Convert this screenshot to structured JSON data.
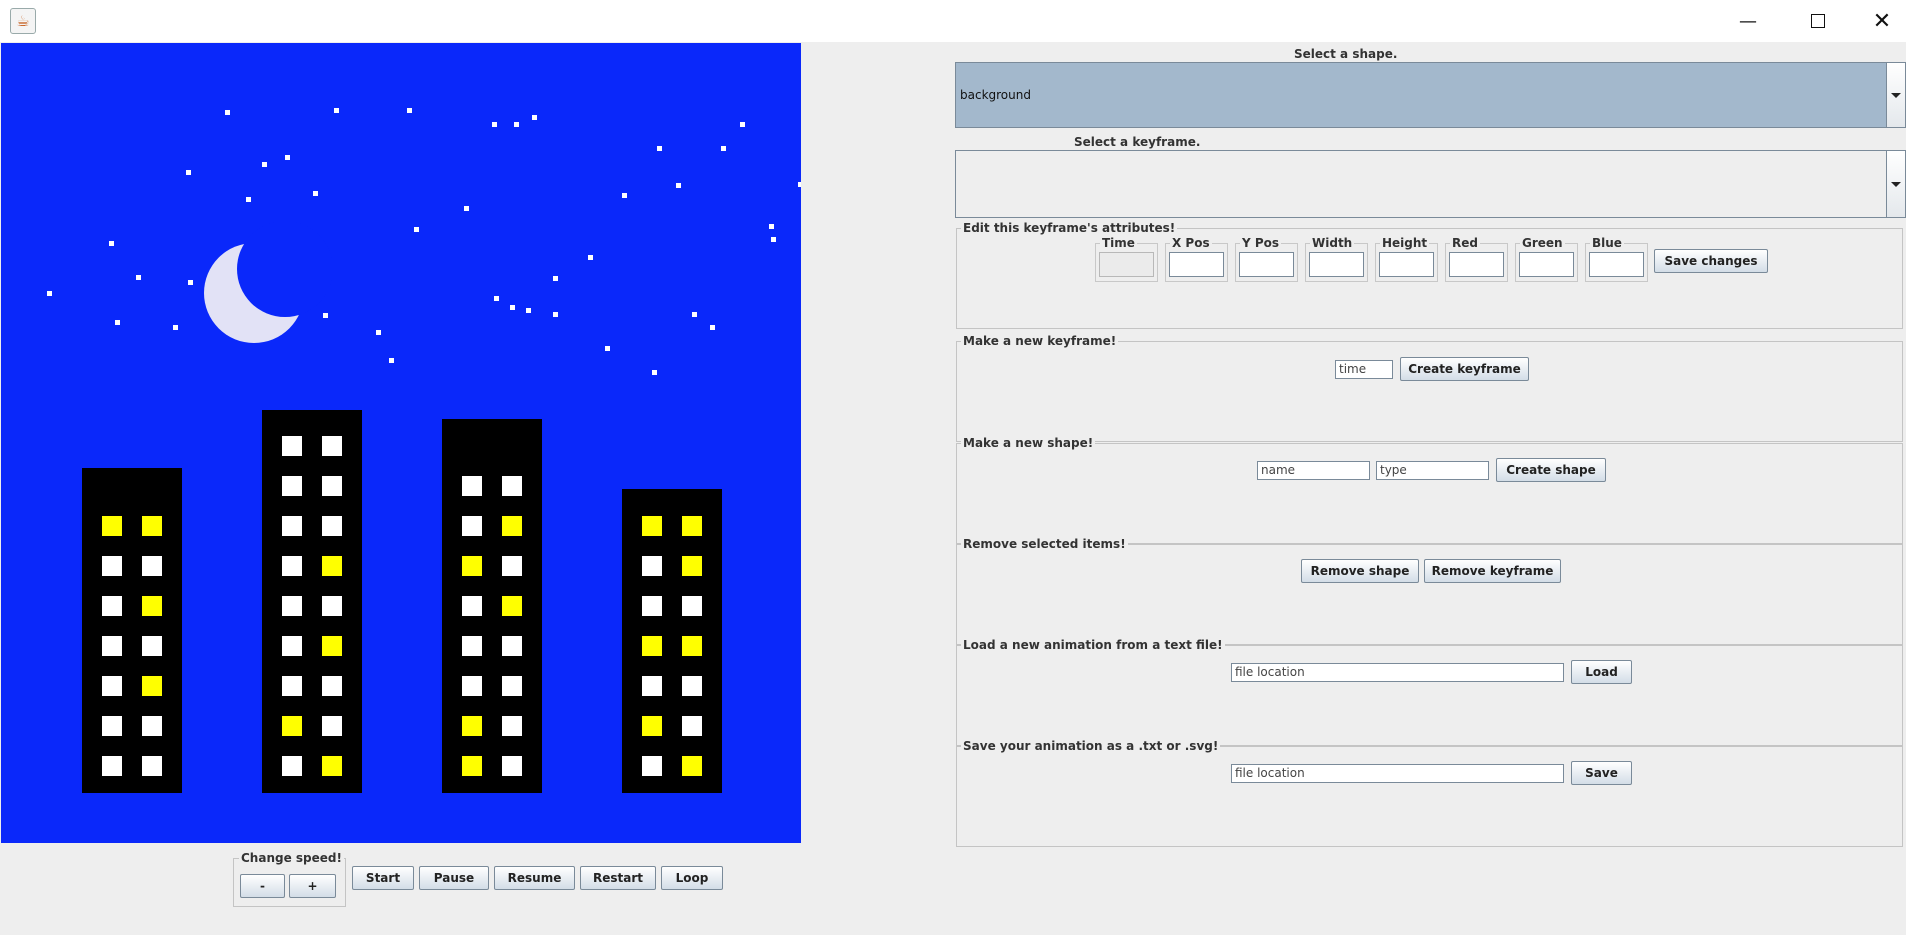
{
  "window": {
    "app_icon": "java-cup-icon",
    "minimize_icon": "minimize-icon",
    "maximize_icon": "maximize-icon",
    "close_icon": "close-icon"
  },
  "animation_canvas": {
    "background_color": "#0a28fa",
    "building_color": "#000000",
    "lit_window_color": "#ffff00",
    "unlit_window_color": "#ffffff",
    "moon_color": "#e2e2f6",
    "star_color": "#ffffff",
    "buildings": [
      {
        "rows": [
          [
            "lit",
            "lit"
          ],
          [
            "unlit",
            "unlit"
          ],
          [
            "unlit",
            "lit"
          ],
          [
            "unlit",
            "unlit"
          ],
          [
            "unlit",
            "lit"
          ],
          [
            "unlit",
            "unlit"
          ],
          [
            "unlit",
            "unlit"
          ]
        ]
      },
      {
        "rows": [
          [
            "unlit",
            "unlit"
          ],
          [
            "unlit",
            "unlit"
          ],
          [
            "unlit",
            "unlit"
          ],
          [
            "unlit",
            "lit"
          ],
          [
            "unlit",
            "unlit"
          ],
          [
            "unlit",
            "lit"
          ],
          [
            "unlit",
            "unlit"
          ],
          [
            "lit",
            "unlit"
          ],
          [
            "unlit",
            "lit"
          ]
        ]
      },
      {
        "rows": [
          [
            "unlit",
            "unlit"
          ],
          [
            "unlit",
            "lit"
          ],
          [
            "lit",
            "unlit"
          ],
          [
            "unlit",
            "lit"
          ],
          [
            "unlit",
            "unlit"
          ],
          [
            "unlit",
            "unlit"
          ],
          [
            "lit",
            "unlit"
          ],
          [
            "lit",
            "unlit"
          ]
        ]
      },
      {
        "rows": [
          [
            "lit",
            "lit"
          ],
          [
            "unlit",
            "lit"
          ],
          [
            "unlit",
            "unlit"
          ],
          [
            "lit",
            "lit"
          ],
          [
            "unlit",
            "unlit"
          ],
          [
            "lit",
            "unlit"
          ],
          [
            "unlit",
            "lit"
          ]
        ]
      }
    ]
  },
  "speed_panel": {
    "title": "Change speed!",
    "decrease_label": "-",
    "increase_label": "+"
  },
  "playback": {
    "start_label": "Start",
    "pause_label": "Pause",
    "resume_label": "Resume",
    "restart_label": "Restart",
    "loop_label": "Loop"
  },
  "shape_selector": {
    "label": "Select a shape.",
    "value": "background",
    "selected_bg": "#a3b8cc"
  },
  "keyframe_selector": {
    "label": "Select a keyframe.",
    "value": ""
  },
  "edit_keyframe": {
    "title": "Edit this keyframe's attributes!",
    "fields": [
      {
        "label": "Time",
        "value": "",
        "enabled": false
      },
      {
        "label": "X Pos",
        "value": "",
        "enabled": true
      },
      {
        "label": "Y Pos",
        "value": "",
        "enabled": true
      },
      {
        "label": "Width",
        "value": "",
        "enabled": true
      },
      {
        "label": "Height",
        "value": "",
        "enabled": true
      },
      {
        "label": "Red",
        "value": "",
        "enabled": true
      },
      {
        "label": "Green",
        "value": "",
        "enabled": true
      },
      {
        "label": "Blue",
        "value": "",
        "enabled": true
      }
    ],
    "save_label": "Save changes"
  },
  "new_keyframe": {
    "title": "Make a new keyframe!",
    "time_value": "time",
    "create_label": "Create keyframe"
  },
  "new_shape": {
    "title": "Make a new shape!",
    "name_value": "name",
    "type_value": "type",
    "create_label": "Create shape"
  },
  "remove_items": {
    "title": "Remove selected items!",
    "remove_shape_label": "Remove shape",
    "remove_keyframe_label": "Remove keyframe"
  },
  "load_animation": {
    "title": "Load a new animation from a text file!",
    "location_value": "file location",
    "load_label": "Load"
  },
  "save_animation": {
    "title": "Save your animation as a .txt or .svg!",
    "location_value": "file location",
    "save_label": "Save"
  }
}
